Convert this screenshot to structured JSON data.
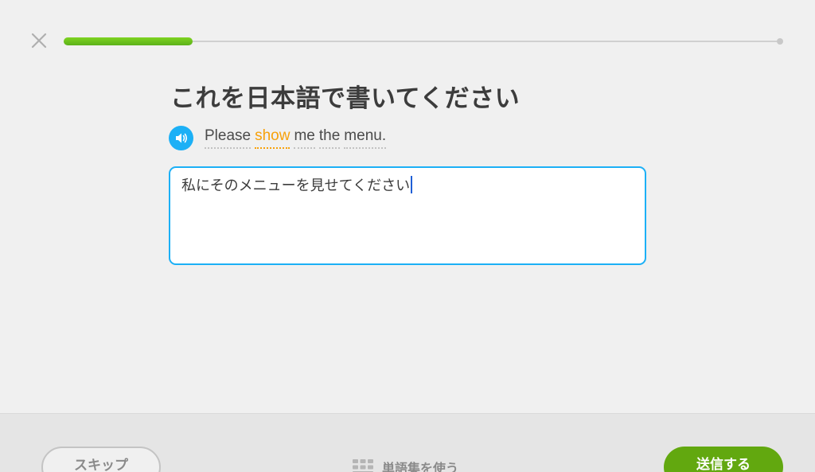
{
  "header": {
    "close_icon": "close-icon",
    "progress": {
      "fraction": 0.18,
      "fill_color": "#6cc51e",
      "track_color": "#d0d0d0"
    }
  },
  "prompt": {
    "title": "これを日本語で書いてください",
    "speaker_icon": "speaker-icon",
    "sentence_words": [
      {
        "text": "Please",
        "hint": false
      },
      {
        "text": "show",
        "hint": true
      },
      {
        "text": "me",
        "hint": false
      },
      {
        "text": "the",
        "hint": false
      },
      {
        "text": "menu.",
        "hint": false
      }
    ]
  },
  "answer": {
    "value": "私にそのメニューを見せてください",
    "border_color": "#1cb0f6"
  },
  "footer": {
    "skip_label": "スキップ",
    "wordbank_label": "単語集を使う",
    "wordbank_icon": "keyboard-grid-icon",
    "submit_label": "送信する",
    "submit_color": "#62a80f"
  }
}
